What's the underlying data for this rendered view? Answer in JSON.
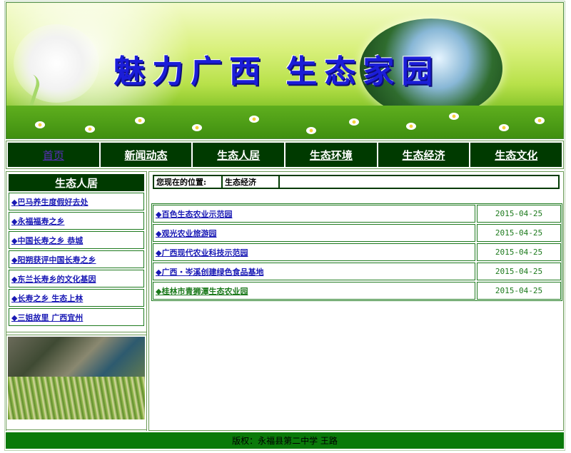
{
  "banner": {
    "title": "魅力广西 生态家园"
  },
  "nav": {
    "items": [
      {
        "label": "首页",
        "active": true
      },
      {
        "label": "新闻动态",
        "active": false
      },
      {
        "label": "生态人居",
        "active": false
      },
      {
        "label": "生态环境",
        "active": false
      },
      {
        "label": "生态经济",
        "active": false
      },
      {
        "label": "生态文化",
        "active": false
      }
    ]
  },
  "sidebar": {
    "heading": "生态人居",
    "items": [
      {
        "label": "◆巴马养生度假好去处"
      },
      {
        "label": "◆永福福寿之乡"
      },
      {
        "label": "◆中国长寿之乡 恭城"
      },
      {
        "label": "◆阳朔获评中国长寿之乡"
      },
      {
        "label": "◆东兰长寿乡的文化基因"
      },
      {
        "label": "◆长寿之乡 生态上林"
      },
      {
        "label": "◆三姐故里 广西宜州"
      }
    ]
  },
  "main": {
    "breadcrumb_label": "您现在的位置:",
    "breadcrumb_value": "生态经济",
    "news": [
      {
        "title": "◆百色生态农业示范园",
        "date": "2015-04-25"
      },
      {
        "title": "◆观光农业旅游园",
        "date": "2015-04-25"
      },
      {
        "title": "◆广西现代农业科技示范园",
        "date": "2015-04-25"
      },
      {
        "title": "◆广西・岑溪创建绿色食品基地",
        "date": "2015-04-25"
      },
      {
        "title": "◆桂林市青狮潭生态农业园",
        "date": "2015-04-25"
      }
    ]
  },
  "footer": {
    "text": "版权：永福县第二中学 王路"
  },
  "colors": {
    "nav_bg": "#003a00",
    "link": "#1a1ab5",
    "date_green": "#1c7a1c",
    "footer_bg": "#0a7a0a",
    "title_blue": "#1b1dd8"
  }
}
